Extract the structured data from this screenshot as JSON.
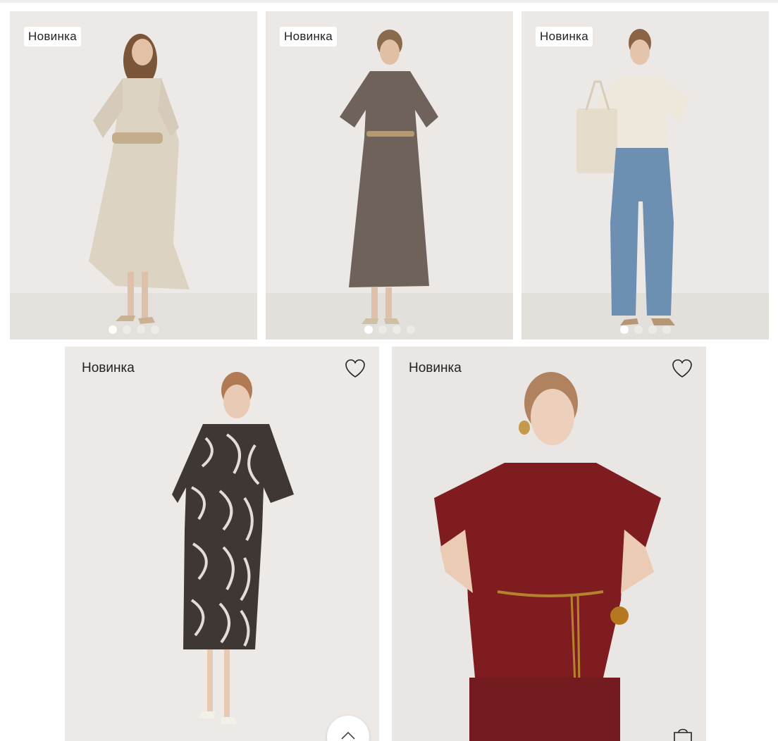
{
  "colors": {
    "card_bg": "#ebe8e6",
    "badge_bg": "#ffffff",
    "text": "#222222"
  },
  "products": [
    {
      "badge": "Новинка",
      "garment": "beige shirt dress with belt",
      "image_dots": 4,
      "active_dot": 1
    },
    {
      "badge": "Новинка",
      "garment": "brown midi dress with cord belt",
      "image_dots": 4,
      "active_dot": 1
    },
    {
      "badge": "Новинка",
      "garment": "white polo top and wide jeans",
      "image_dots": 4,
      "active_dot": 1
    },
    {
      "badge": "Новинка",
      "garment": "zebra print wrap dress",
      "favorite_icon": "heart-outline-icon"
    },
    {
      "badge": "Новинка",
      "garment": "burgundy blouse with cord belt",
      "favorite_icon": "heart-outline-icon",
      "cart_icon": "shopping-bag-icon"
    }
  ],
  "scroll_top_icon": "chevron-up-icon"
}
